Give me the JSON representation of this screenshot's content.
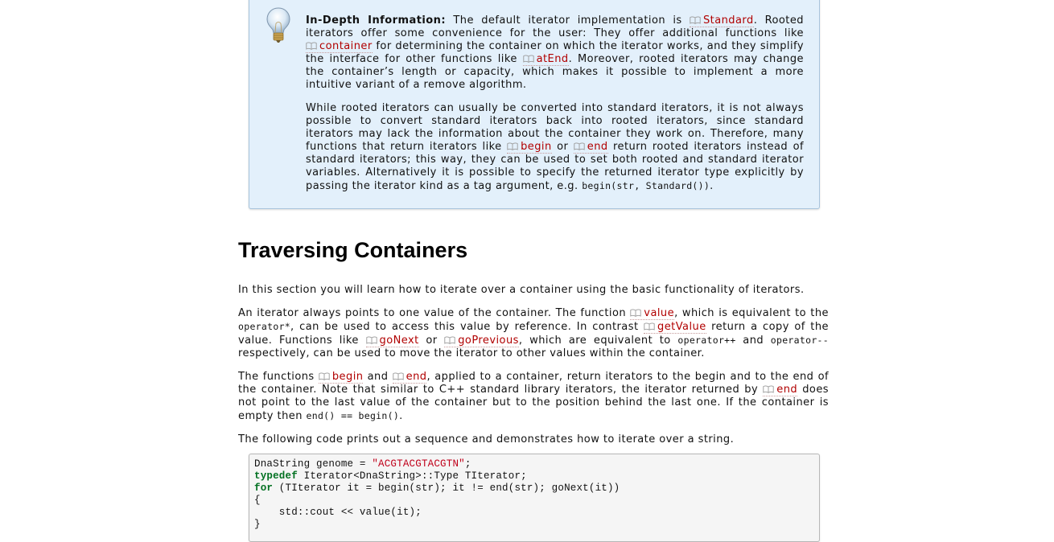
{
  "info_box": {
    "icon": "lightbulb-icon",
    "p1": [
      {
        "t": "b",
        "v": "In-Depth Information:"
      },
      {
        "t": "text",
        "v": " The default iterator implementation is "
      },
      {
        "t": "link",
        "v": "Standard"
      },
      {
        "t": "text",
        "v": ". Rooted iterators offer some convenience for the user: They offer additional functions like "
      },
      {
        "t": "link",
        "v": "container"
      },
      {
        "t": "text",
        "v": " for determining the container on which the iterator works, and they simplify the interface for other functions like "
      },
      {
        "t": "link",
        "v": "atEnd"
      },
      {
        "t": "text",
        "v": ". Moreover, rooted iterators may change the container’s length or capacity, which makes it possible to implement a more intuitive variant of a remove algorithm."
      }
    ],
    "p2": [
      {
        "t": "text",
        "v": "While rooted iterators can usually be converted into standard iterators, it is not always possible to convert standard iterators back into rooted iterators, since standard iterators may lack the information about the container they work on. Therefore, many functions that return iterators like "
      },
      {
        "t": "link",
        "v": "begin"
      },
      {
        "t": "text",
        "v": " or "
      },
      {
        "t": "link",
        "v": "end"
      },
      {
        "t": "text",
        "v": " return rooted iterators instead of standard iterators; this way, they can be used to set both rooted and standard iterator variables. Alternatively it is possible to specify the returned iterator type explicitly by passing the iterator kind as a tag argument, e.g. "
      },
      {
        "t": "code",
        "v": "begin(str, Standard())"
      },
      {
        "t": "text",
        "v": "."
      }
    ]
  },
  "section": {
    "title": "Traversing Containers",
    "p1": [
      {
        "t": "text",
        "v": "In this section you will learn how to iterate over a container using the basic functionality of iterators."
      }
    ],
    "p2": [
      {
        "t": "text",
        "v": "An iterator always points to one value of the container. The function "
      },
      {
        "t": "link",
        "v": "value"
      },
      {
        "t": "text",
        "v": ", which is equivalent to the "
      },
      {
        "t": "code",
        "v": "operator*"
      },
      {
        "t": "text",
        "v": ", can be used to access this value by reference. In contrast "
      },
      {
        "t": "link",
        "v": "getValue"
      },
      {
        "t": "text",
        "v": " return a copy of the value. Functions like "
      },
      {
        "t": "link",
        "v": "goNext"
      },
      {
        "t": "text",
        "v": " or "
      },
      {
        "t": "link",
        "v": "goPrevious"
      },
      {
        "t": "text",
        "v": ", which are equivalent to "
      },
      {
        "t": "code",
        "v": "operator++"
      },
      {
        "t": "text",
        "v": " and "
      },
      {
        "t": "code",
        "v": "operator--"
      },
      {
        "t": "text",
        "v": " respectively, can be used to move the iterator to other values within the container."
      }
    ],
    "p3": [
      {
        "t": "text",
        "v": "The functions "
      },
      {
        "t": "link",
        "v": "begin"
      },
      {
        "t": "text",
        "v": " and "
      },
      {
        "t": "link",
        "v": "end"
      },
      {
        "t": "text",
        "v": ", applied to a container, return iterators to the begin and to the end of the container. Note that similar to C++ standard library iterators, the iterator returned by "
      },
      {
        "t": "link",
        "v": "end"
      },
      {
        "t": "text",
        "v": " does not point to the last value of the container but to the position behind the last one. If the container is empty then "
      },
      {
        "t": "code",
        "v": "end() == begin()"
      },
      {
        "t": "text",
        "v": "."
      }
    ],
    "p4": [
      {
        "t": "text",
        "v": "The following code prints out a sequence and demonstrates how to iterate over a string."
      }
    ]
  },
  "code_lines": [
    [
      {
        "t": "plain",
        "v": "DnaString genome = "
      },
      {
        "t": "str",
        "v": "\"ACGTACGTACGTN\""
      },
      {
        "t": "plain",
        "v": ";"
      }
    ],
    [
      {
        "t": "kw",
        "v": "typedef"
      },
      {
        "t": "plain",
        "v": " Iterator<DnaString>::Type TIterator;"
      }
    ],
    [
      {
        "t": "kw",
        "v": "for"
      },
      {
        "t": "plain",
        "v": " (TIterator it = begin(str); it != end(str); goNext(it))"
      }
    ],
    [
      {
        "t": "plain",
        "v": "{"
      }
    ],
    [
      {
        "t": "plain",
        "v": "    std::cout << value(it);"
      }
    ],
    [
      {
        "t": "plain",
        "v": "}"
      }
    ]
  ]
}
